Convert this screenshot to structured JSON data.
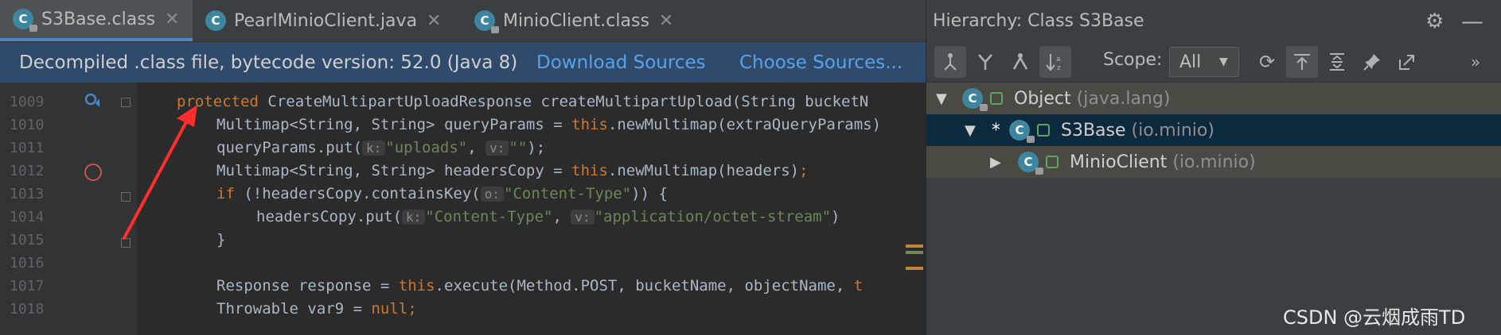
{
  "editor": {
    "tabs": [
      {
        "icon": "C",
        "label": "S3Base.class",
        "active": true
      },
      {
        "icon": "C",
        "label": "PearlMinioClient.java",
        "active": false
      },
      {
        "icon": "C",
        "label": "MinioClient.class",
        "active": false
      }
    ],
    "banner": {
      "message": "Decompiled .class file, bytecode version: 52.0 (Java 8)",
      "download_sources": "Download Sources",
      "choose_sources": "Choose Sources..."
    },
    "line_numbers": [
      "1009",
      "1010",
      "1011",
      "1012",
      "1013",
      "1014",
      "1015",
      "1016",
      "1017",
      "1018"
    ],
    "code": {
      "l1009_kw": "protected",
      "l1009_rest": " CreateMultipartUploadResponse createMultipartUpload(String bucketN",
      "l1010_a": "Multimap<String, String> queryParams = ",
      "l1010_kw": "this",
      "l1010_b": ".newMultimap(extraQueryParams)",
      "l1011_a": "queryParams.put(",
      "l1011_h1": "k:",
      "l1011_s1": "\"uploads\"",
      "l1011_c": ", ",
      "l1011_h2": "v:",
      "l1011_s2": "\"\"",
      "l1011_d": ");",
      "l1012_a": "Multimap<String, String> headersCopy = ",
      "l1012_kw": "this",
      "l1012_b": ".newMultimap(headers)",
      "l1012_semi": ";",
      "l1013_kw": "if",
      "l1013_a": " (!headersCopy.containsKey(",
      "l1013_h": "o:",
      "l1013_s": "\"Content-Type\"",
      "l1013_b": ")) {",
      "l1014_a": "headersCopy.put(",
      "l1014_h1": "k:",
      "l1014_s1": "\"Content-Type\"",
      "l1014_c": ", ",
      "l1014_h2": "v:",
      "l1014_s2": "\"application/octet-stream\"",
      "l1014_d": ")",
      "l1015": "}",
      "l1017_a": "Response response = ",
      "l1017_kw": "this",
      "l1017_b": ".execute(Method.POST, bucketName, objectName, ",
      "l1017_kw2": "t",
      "l1018_a": "Throwable var9 = ",
      "l1018_kw": "null",
      "l1018_semi": ";"
    }
  },
  "hierarchy": {
    "title": "Hierarchy:  Class S3Base",
    "scope_label": "Scope:",
    "scope_value": "All",
    "nodes": [
      {
        "name": "Object",
        "pkg": "(java.lang)",
        "expanded": true
      },
      {
        "name": "S3Base",
        "pkg": "(io.minio)",
        "expanded": true,
        "current": "*"
      },
      {
        "name": "MinioClient",
        "pkg": "(io.minio)",
        "expanded": false
      }
    ],
    "toolbar_icons": [
      "class-hierarchy-icon",
      "supertypes-icon",
      "subtypes-icon",
      "sort-alphabetically-icon",
      "refresh-icon",
      "scroll-to-source-icon",
      "expand-all-icon",
      "pin-icon",
      "export-icon",
      "more-icon"
    ]
  },
  "watermark": "CSDN @云烟成雨TD",
  "colors": {
    "accent": "#4a88c7",
    "keyword": "#cc7832",
    "string": "#6a8759",
    "annotation": "#ff2d2d"
  }
}
